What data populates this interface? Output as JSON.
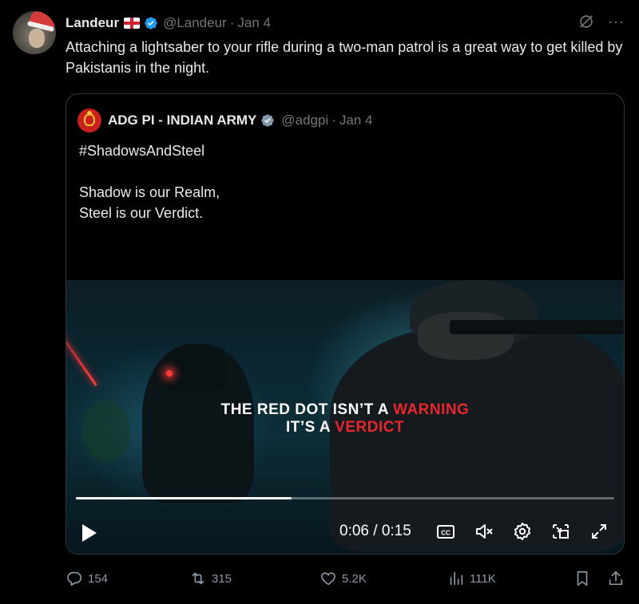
{
  "tweet": {
    "author_name": "Landeur",
    "author_handle": "@Landeur",
    "separator": "·",
    "date": "Jan 4",
    "text": "Attaching a lightsaber to your rifle during a two-man patrol is a great way to get killed by Pakistanis in the night.",
    "more_label": "···"
  },
  "quote": {
    "author_name": "ADG PI - INDIAN ARMY",
    "author_handle": "@adgpi",
    "separator": "·",
    "date": "Jan 4",
    "lines": [
      "#ShadowsAndSteel",
      "",
      "Shadow is our Realm,",
      "Steel is our Verdict."
    ],
    "video": {
      "caption_line1_white": "THE RED DOT ISN’T A ",
      "caption_line1_red": "WARNING",
      "caption_line2_white": "IT’S A ",
      "caption_line2_red": "VERDICT",
      "time": "0:06 / 0:15",
      "progress": 0.4,
      "cc_label": "CC"
    }
  },
  "actions": {
    "replies": "154",
    "reposts": "315",
    "likes": "5.2K",
    "views": "111K"
  },
  "colors": {
    "background": "#000000",
    "text": "#e7e9ea",
    "muted": "#71767b",
    "verified_blue": "#1d9bf0",
    "caption_red": "#e8262b"
  },
  "icons": [
    "verified-badge-icon",
    "grok-icon",
    "more-icon",
    "play-icon",
    "cc-icon",
    "mute-icon",
    "settings-icon",
    "pip-icon",
    "fullscreen-icon",
    "reply-icon",
    "repost-icon",
    "like-icon",
    "views-icon",
    "bookmark-icon",
    "share-icon"
  ]
}
